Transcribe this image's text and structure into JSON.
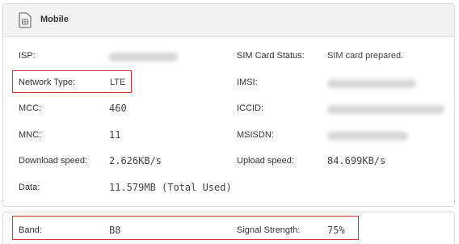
{
  "panel": {
    "title": "Mobile",
    "icon": "sim-card-icon"
  },
  "fields": {
    "isp_label": "ISP:",
    "network_type_label": "Network Type:",
    "network_type_value": "LTE",
    "mcc_label": "MCC:",
    "mcc_value": "460",
    "mnc_label": "MNC:",
    "mnc_value": "11",
    "download_label": "Download speed:",
    "download_value": "2.626KB/s",
    "data_label": "Data:",
    "data_value": "11.579MB (Total Used)",
    "sim_status_label": "SIM Card Status:",
    "sim_status_value": "SIM card prepared.",
    "imsi_label": "IMSI:",
    "iccid_label": "ICCID:",
    "msisdn_label": "MSISDN:",
    "upload_label": "Upload speed:",
    "upload_value": "84.699KB/s"
  },
  "signal": {
    "band_label": "Band:",
    "band_value": "B8",
    "strength_label": "Signal Strength:",
    "strength_value": "75%"
  },
  "colors": {
    "highlight": "#d0383a",
    "header_bg": "#f2f2f2"
  }
}
